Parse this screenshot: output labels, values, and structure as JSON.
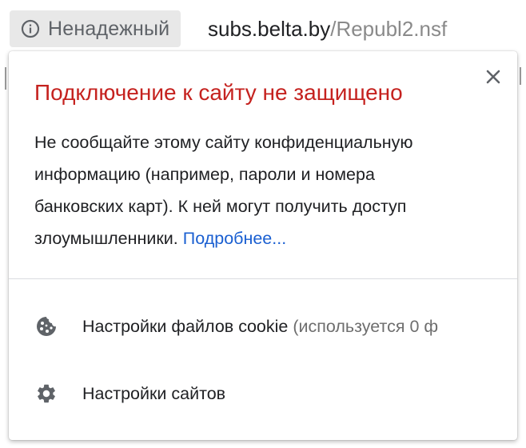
{
  "address_bar": {
    "security_label": "Ненадежный",
    "security_icon": "info-circle-icon",
    "url_host": "subs.belta.by",
    "url_path": "/Republ2.nsf"
  },
  "popup": {
    "title": "Подключение к сайту не защищено",
    "body_lines": [
      "Не сообщайте этому сайту конфиденциальную",
      "информацию (например, пароли и номера",
      "банковских карт). К ней могут получить доступ",
      "злоумышленники."
    ],
    "more_link": "Подробнее...",
    "close_icon": "close-icon",
    "items": [
      {
        "icon": "cookie-icon",
        "label": "Настройки файлов cookie",
        "detail": "(используется 0 ф"
      },
      {
        "icon": "gear-icon",
        "label": "Настройки сайтов"
      }
    ]
  },
  "colors": {
    "title_red": "#c5221f",
    "link_blue": "#1a5fd1",
    "text": "#202124",
    "muted": "#6e6e6e",
    "chip_bg": "#e8e8e8"
  }
}
